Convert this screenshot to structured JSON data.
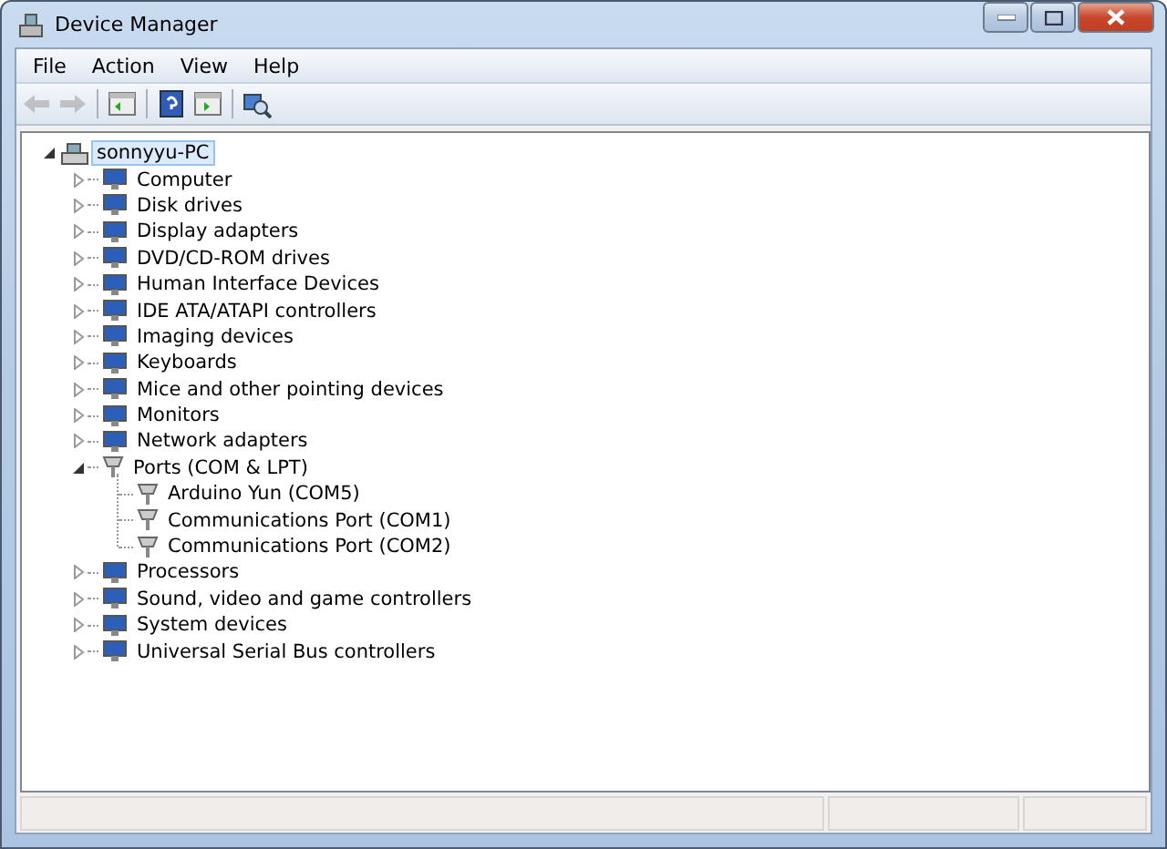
{
  "window": {
    "title": "Device Manager"
  },
  "menu": [
    "File",
    "Action",
    "View",
    "Help"
  ],
  "toolbar": [
    {
      "kind": "back",
      "disabled": true
    },
    {
      "kind": "forward",
      "disabled": true
    },
    {
      "kind": "separator"
    },
    {
      "kind": "tree",
      "disabled": false
    },
    {
      "kind": "separator"
    },
    {
      "kind": "help",
      "disabled": false
    },
    {
      "kind": "pane",
      "disabled": false
    },
    {
      "kind": "separator"
    },
    {
      "kind": "scan",
      "disabled": false
    }
  ],
  "tree": {
    "label": "sonnyyu-PC",
    "expanded": true,
    "selected": true,
    "children": [
      {
        "label": "Computer",
        "expanded": false,
        "selected": false
      },
      {
        "label": "Disk drives",
        "expanded": false,
        "selected": false
      },
      {
        "label": "Display adapters",
        "expanded": false,
        "selected": false
      },
      {
        "label": "DVD/CD-ROM drives",
        "expanded": false,
        "selected": false
      },
      {
        "label": "Human Interface Devices",
        "expanded": false,
        "selected": false
      },
      {
        "label": "IDE ATA/ATAPI controllers",
        "expanded": false,
        "selected": false
      },
      {
        "label": "Imaging devices",
        "expanded": false,
        "selected": false
      },
      {
        "label": "Keyboards",
        "expanded": false,
        "selected": false
      },
      {
        "label": "Mice and other pointing devices",
        "expanded": false,
        "selected": false
      },
      {
        "label": "Monitors",
        "expanded": false,
        "selected": false
      },
      {
        "label": "Network adapters",
        "expanded": false,
        "selected": false
      },
      {
        "label": "Ports (COM & LPT)",
        "expanded": true,
        "selected": false,
        "children": [
          {
            "label": "Arduino Yun (COM5)",
            "selected": false
          },
          {
            "label": "Communications Port (COM1)",
            "selected": false
          },
          {
            "label": "Communications Port (COM2)",
            "selected": false
          }
        ]
      },
      {
        "label": "Processors",
        "expanded": false,
        "selected": false
      },
      {
        "label": "Sound, video and game controllers",
        "expanded": false,
        "selected": false
      },
      {
        "label": "System devices",
        "expanded": false,
        "selected": false
      },
      {
        "label": "Universal Serial Bus controllers",
        "expanded": false,
        "selected": false
      }
    ]
  }
}
